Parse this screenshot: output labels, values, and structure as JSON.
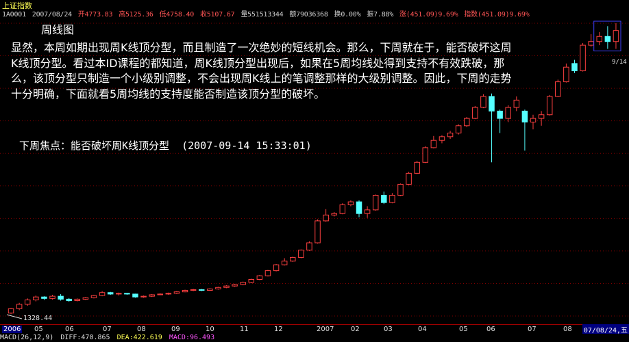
{
  "index_name": "上证指数",
  "quote": {
    "code": "1A0001",
    "date": "2007/08/24",
    "open": "开4773.83",
    "high": "高5125.36",
    "low": "低4758.40",
    "close": "收5107.67",
    "volume": "量551513344",
    "amount": "额79036368",
    "turnover": "换0.00%",
    "amplitude": "振7.88%",
    "change": "涨(451.09)9.69%",
    "index_change": "指数(451.09)9.69%"
  },
  "chart_caption": "周线图",
  "comment": "显然，本周如期出现周K线顶分型，而且制造了一次绝妙的短线机会。那么，下周就在于，能否破坏这周K线顶分型。看过本ID课程的都知道，周K线顶分型出现后，如果在5周均线处得到支持不有效跌破，那么，该顶分型只制造一个小级别调整，不会出现周K线上的笔调整那样的大级别调整。因此，下周的走势十分明确，下面就看5周均线的支持度能否制造该顶分型的破坏。",
  "focus": "下周焦点：能否破坏周K线顶分型  (2007-09-14 15:33:01)",
  "low_label": "1328.44",
  "high_label": "9/14",
  "x_axis": [
    "2006",
    "05",
    "06",
    "07",
    "08",
    "09",
    "10",
    "11",
    "12",
    "2007",
    "02",
    "03",
    "04",
    "05",
    "06",
    "07",
    "08"
  ],
  "date_box": "07/08/24,五",
  "macd": {
    "params": "MACD(26,12,9)",
    "diff": "DIFF:470.865",
    "dea": "DEA:422.619",
    "macd": "MACD:96.493"
  },
  "colors": {
    "up": "#ff4040",
    "down": "#55ffff",
    "grid": "#800000",
    "highlight": "#4040ff"
  },
  "chart_data": {
    "type": "candlestick",
    "title": "周线图",
    "series": [
      {
        "o": 1340,
        "c": 1400,
        "h": 1410,
        "l": 1328
      },
      {
        "o": 1400,
        "c": 1460,
        "h": 1480,
        "l": 1380
      },
      {
        "o": 1460,
        "c": 1520,
        "h": 1540,
        "l": 1440
      },
      {
        "o": 1520,
        "c": 1560,
        "h": 1580,
        "l": 1500
      },
      {
        "o": 1560,
        "c": 1540,
        "h": 1570,
        "l": 1520
      },
      {
        "o": 1540,
        "c": 1570,
        "h": 1590,
        "l": 1525
      },
      {
        "o": 1570,
        "c": 1530,
        "h": 1600,
        "l": 1510
      },
      {
        "o": 1530,
        "c": 1510,
        "h": 1545,
        "l": 1495
      },
      {
        "o": 1510,
        "c": 1530,
        "h": 1540,
        "l": 1500
      },
      {
        "o": 1530,
        "c": 1550,
        "h": 1560,
        "l": 1520
      },
      {
        "o": 1550,
        "c": 1580,
        "h": 1590,
        "l": 1540
      },
      {
        "o": 1580,
        "c": 1620,
        "h": 1640,
        "l": 1570
      },
      {
        "o": 1620,
        "c": 1600,
        "h": 1630,
        "l": 1590
      },
      {
        "o": 1600,
        "c": 1610,
        "h": 1620,
        "l": 1580
      },
      {
        "o": 1610,
        "c": 1600,
        "h": 1615,
        "l": 1590
      },
      {
        "o": 1600,
        "c": 1560,
        "h": 1605,
        "l": 1550
      },
      {
        "o": 1560,
        "c": 1570,
        "h": 1580,
        "l": 1550
      },
      {
        "o": 1570,
        "c": 1590,
        "h": 1600,
        "l": 1560
      },
      {
        "o": 1590,
        "c": 1600,
        "h": 1610,
        "l": 1585
      },
      {
        "o": 1600,
        "c": 1610,
        "h": 1620,
        "l": 1590
      },
      {
        "o": 1610,
        "c": 1630,
        "h": 1640,
        "l": 1600
      },
      {
        "o": 1630,
        "c": 1650,
        "h": 1660,
        "l": 1625
      },
      {
        "o": 1650,
        "c": 1660,
        "h": 1670,
        "l": 1640
      },
      {
        "o": 1660,
        "c": 1650,
        "h": 1670,
        "l": 1640
      },
      {
        "o": 1650,
        "c": 1670,
        "h": 1680,
        "l": 1645
      },
      {
        "o": 1670,
        "c": 1690,
        "h": 1700,
        "l": 1660
      },
      {
        "o": 1690,
        "c": 1710,
        "h": 1720,
        "l": 1680
      },
      {
        "o": 1710,
        "c": 1730,
        "h": 1740,
        "l": 1700
      },
      {
        "o": 1730,
        "c": 1760,
        "h": 1770,
        "l": 1720
      },
      {
        "o": 1760,
        "c": 1800,
        "h": 1810,
        "l": 1750
      },
      {
        "o": 1800,
        "c": 1850,
        "h": 1860,
        "l": 1790
      },
      {
        "o": 1850,
        "c": 1920,
        "h": 1930,
        "l": 1840
      },
      {
        "o": 1920,
        "c": 2000,
        "h": 2010,
        "l": 1910
      },
      {
        "o": 2000,
        "c": 2050,
        "h": 2090,
        "l": 1990
      },
      {
        "o": 2050,
        "c": 2100,
        "h": 2110,
        "l": 2040
      },
      {
        "o": 2100,
        "c": 2200,
        "h": 2210,
        "l": 2090
      },
      {
        "o": 2200,
        "c": 2300,
        "h": 2320,
        "l": 2190
      },
      {
        "o": 2300,
        "c": 2600,
        "h": 2620,
        "l": 2290
      },
      {
        "o": 2600,
        "c": 2680,
        "h": 2760,
        "l": 2590
      },
      {
        "o": 2680,
        "c": 2700,
        "h": 2720,
        "l": 2660
      },
      {
        "o": 2700,
        "c": 2820,
        "h": 2840,
        "l": 2690
      },
      {
        "o": 2820,
        "c": 2860,
        "h": 2880,
        "l": 2800
      },
      {
        "o": 2860,
        "c": 2700,
        "h": 2880,
        "l": 2650
      },
      {
        "o": 2700,
        "c": 2750,
        "h": 2800,
        "l": 2640
      },
      {
        "o": 2750,
        "c": 2950,
        "h": 2960,
        "l": 2740
      },
      {
        "o": 2950,
        "c": 2850,
        "h": 3000,
        "l": 2830
      },
      {
        "o": 2850,
        "c": 2950,
        "h": 2980,
        "l": 2840
      },
      {
        "o": 2950,
        "c": 3100,
        "h": 3110,
        "l": 2940
      },
      {
        "o": 3100,
        "c": 3250,
        "h": 3270,
        "l": 3090
      },
      {
        "o": 3250,
        "c": 3400,
        "h": 3420,
        "l": 3240
      },
      {
        "o": 3400,
        "c": 3600,
        "h": 3620,
        "l": 3390
      },
      {
        "o": 3600,
        "c": 3700,
        "h": 3760,
        "l": 3590
      },
      {
        "o": 3700,
        "c": 3750,
        "h": 3770,
        "l": 3660
      },
      {
        "o": 3750,
        "c": 3800,
        "h": 3830,
        "l": 3720
      },
      {
        "o": 3800,
        "c": 3900,
        "h": 3920,
        "l": 3780
      },
      {
        "o": 3900,
        "c": 4000,
        "h": 4020,
        "l": 3880
      },
      {
        "o": 4000,
        "c": 4150,
        "h": 4170,
        "l": 3990
      },
      {
        "o": 4150,
        "c": 4300,
        "h": 4330,
        "l": 4140
      },
      {
        "o": 4300,
        "c": 4100,
        "h": 4340,
        "l": 3400
      },
      {
        "o": 4100,
        "c": 4000,
        "h": 4120,
        "l": 3800
      },
      {
        "o": 4000,
        "c": 4150,
        "h": 4180,
        "l": 3950
      },
      {
        "o": 4150,
        "c": 4250,
        "h": 4300,
        "l": 4100
      },
      {
        "o": 4100,
        "c": 3950,
        "h": 4120,
        "l": 3560
      },
      {
        "o": 3950,
        "c": 4000,
        "h": 4050,
        "l": 3850
      },
      {
        "o": 4000,
        "c": 4050,
        "h": 4100,
        "l": 3900
      },
      {
        "o": 4050,
        "c": 4300,
        "h": 4320,
        "l": 4040
      },
      {
        "o": 4300,
        "c": 4500,
        "h": 4530,
        "l": 4290
      },
      {
        "o": 4500,
        "c": 4700,
        "h": 4750,
        "l": 4490
      },
      {
        "o": 4750,
        "c": 4650,
        "h": 4800,
        "l": 4620
      },
      {
        "o": 4650,
        "c": 5000,
        "h": 5030,
        "l": 4640
      },
      {
        "o": 5000,
        "c": 5050,
        "h": 5150,
        "l": 4980
      },
      {
        "o": 5050,
        "c": 5120,
        "h": 5180,
        "l": 5000
      },
      {
        "o": 5120,
        "c": 5050,
        "h": 5260,
        "l": 4950
      },
      {
        "o": 5050,
        "c": 5200,
        "h": 5300,
        "l": 4950
      }
    ],
    "xlabel": "",
    "ylabel": "",
    "ylim": [
      1300,
      5300
    ],
    "grid": true
  }
}
